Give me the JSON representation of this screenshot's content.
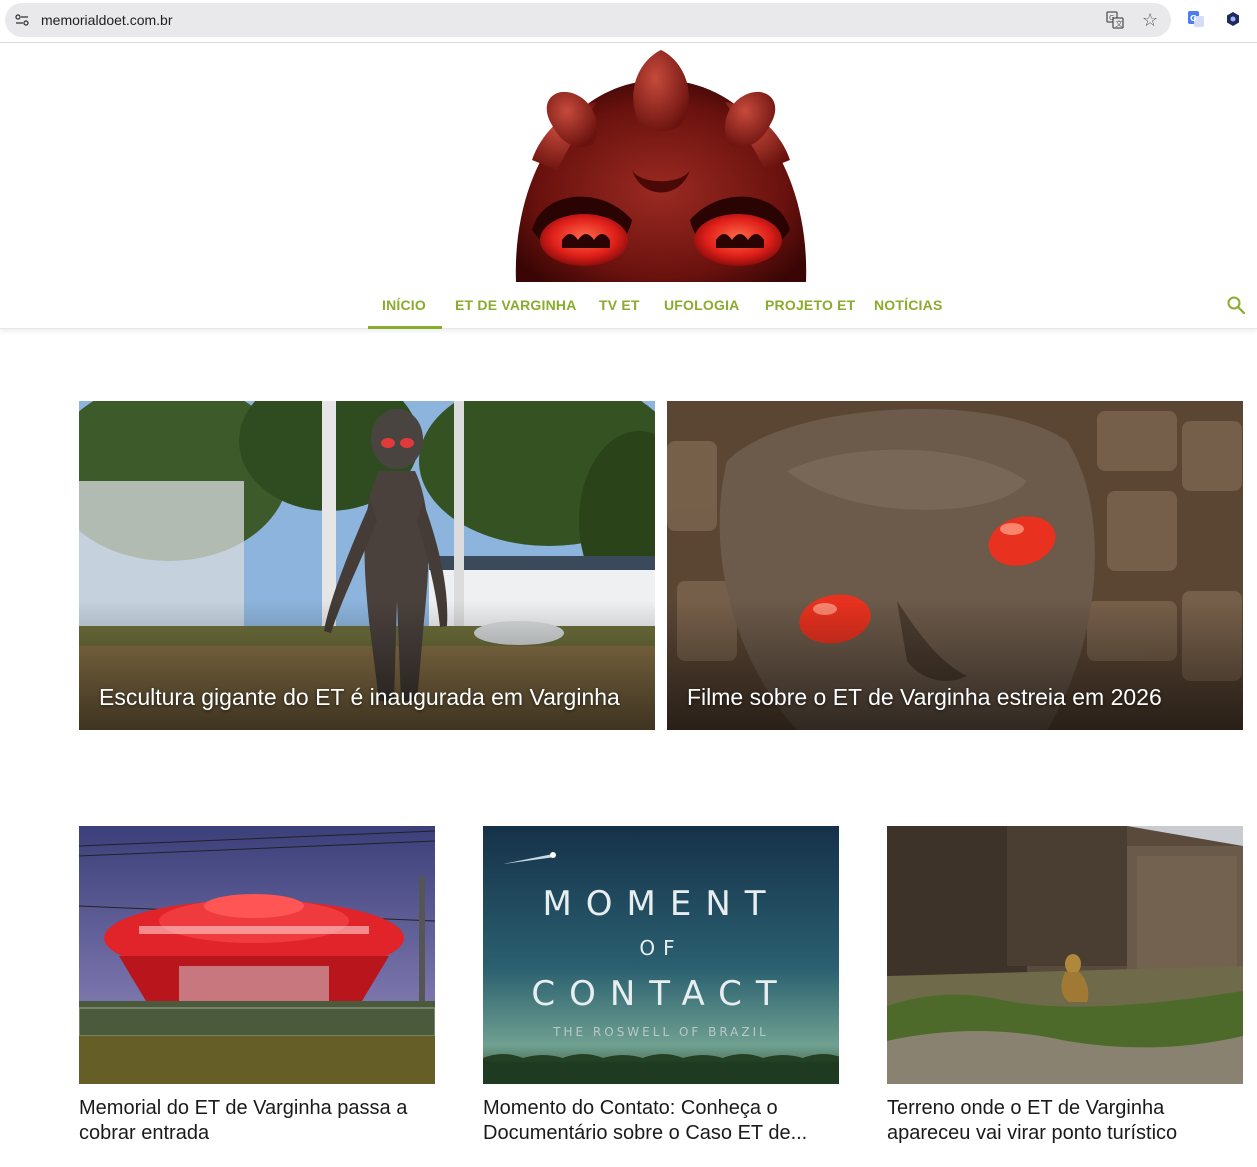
{
  "browser": {
    "url": "memorialdoet.com.br"
  },
  "nav": {
    "items": [
      {
        "label": "INÍCIO",
        "active": true
      },
      {
        "label": "ET DE VARGINHA"
      },
      {
        "label": "TV ET"
      },
      {
        "label": "UFOLOGIA"
      },
      {
        "label": "PROJETO ET"
      },
      {
        "label": "NOTÍCIAS"
      }
    ]
  },
  "featured": [
    {
      "title": "Escultura gigante do ET é inaugurada em Varginha"
    },
    {
      "title": "Filme sobre o ET de Varginha estreia em 2026"
    }
  ],
  "articles": [
    {
      "title": "Memorial do ET de Varginha passa a cobrar entrada"
    },
    {
      "title": "Momento do Contato: Conheça o Documentário sobre o Caso ET de...",
      "poster": {
        "line1": "MOMENT",
        "line2": "OF",
        "line3": "CONTACT",
        "line4": "THE ROSWELL OF BRAZIL"
      }
    },
    {
      "title": "Terreno onde o ET de Varginha apareceu vai virar ponto turístico"
    }
  ],
  "colors": {
    "accent": "#8aab2c"
  }
}
